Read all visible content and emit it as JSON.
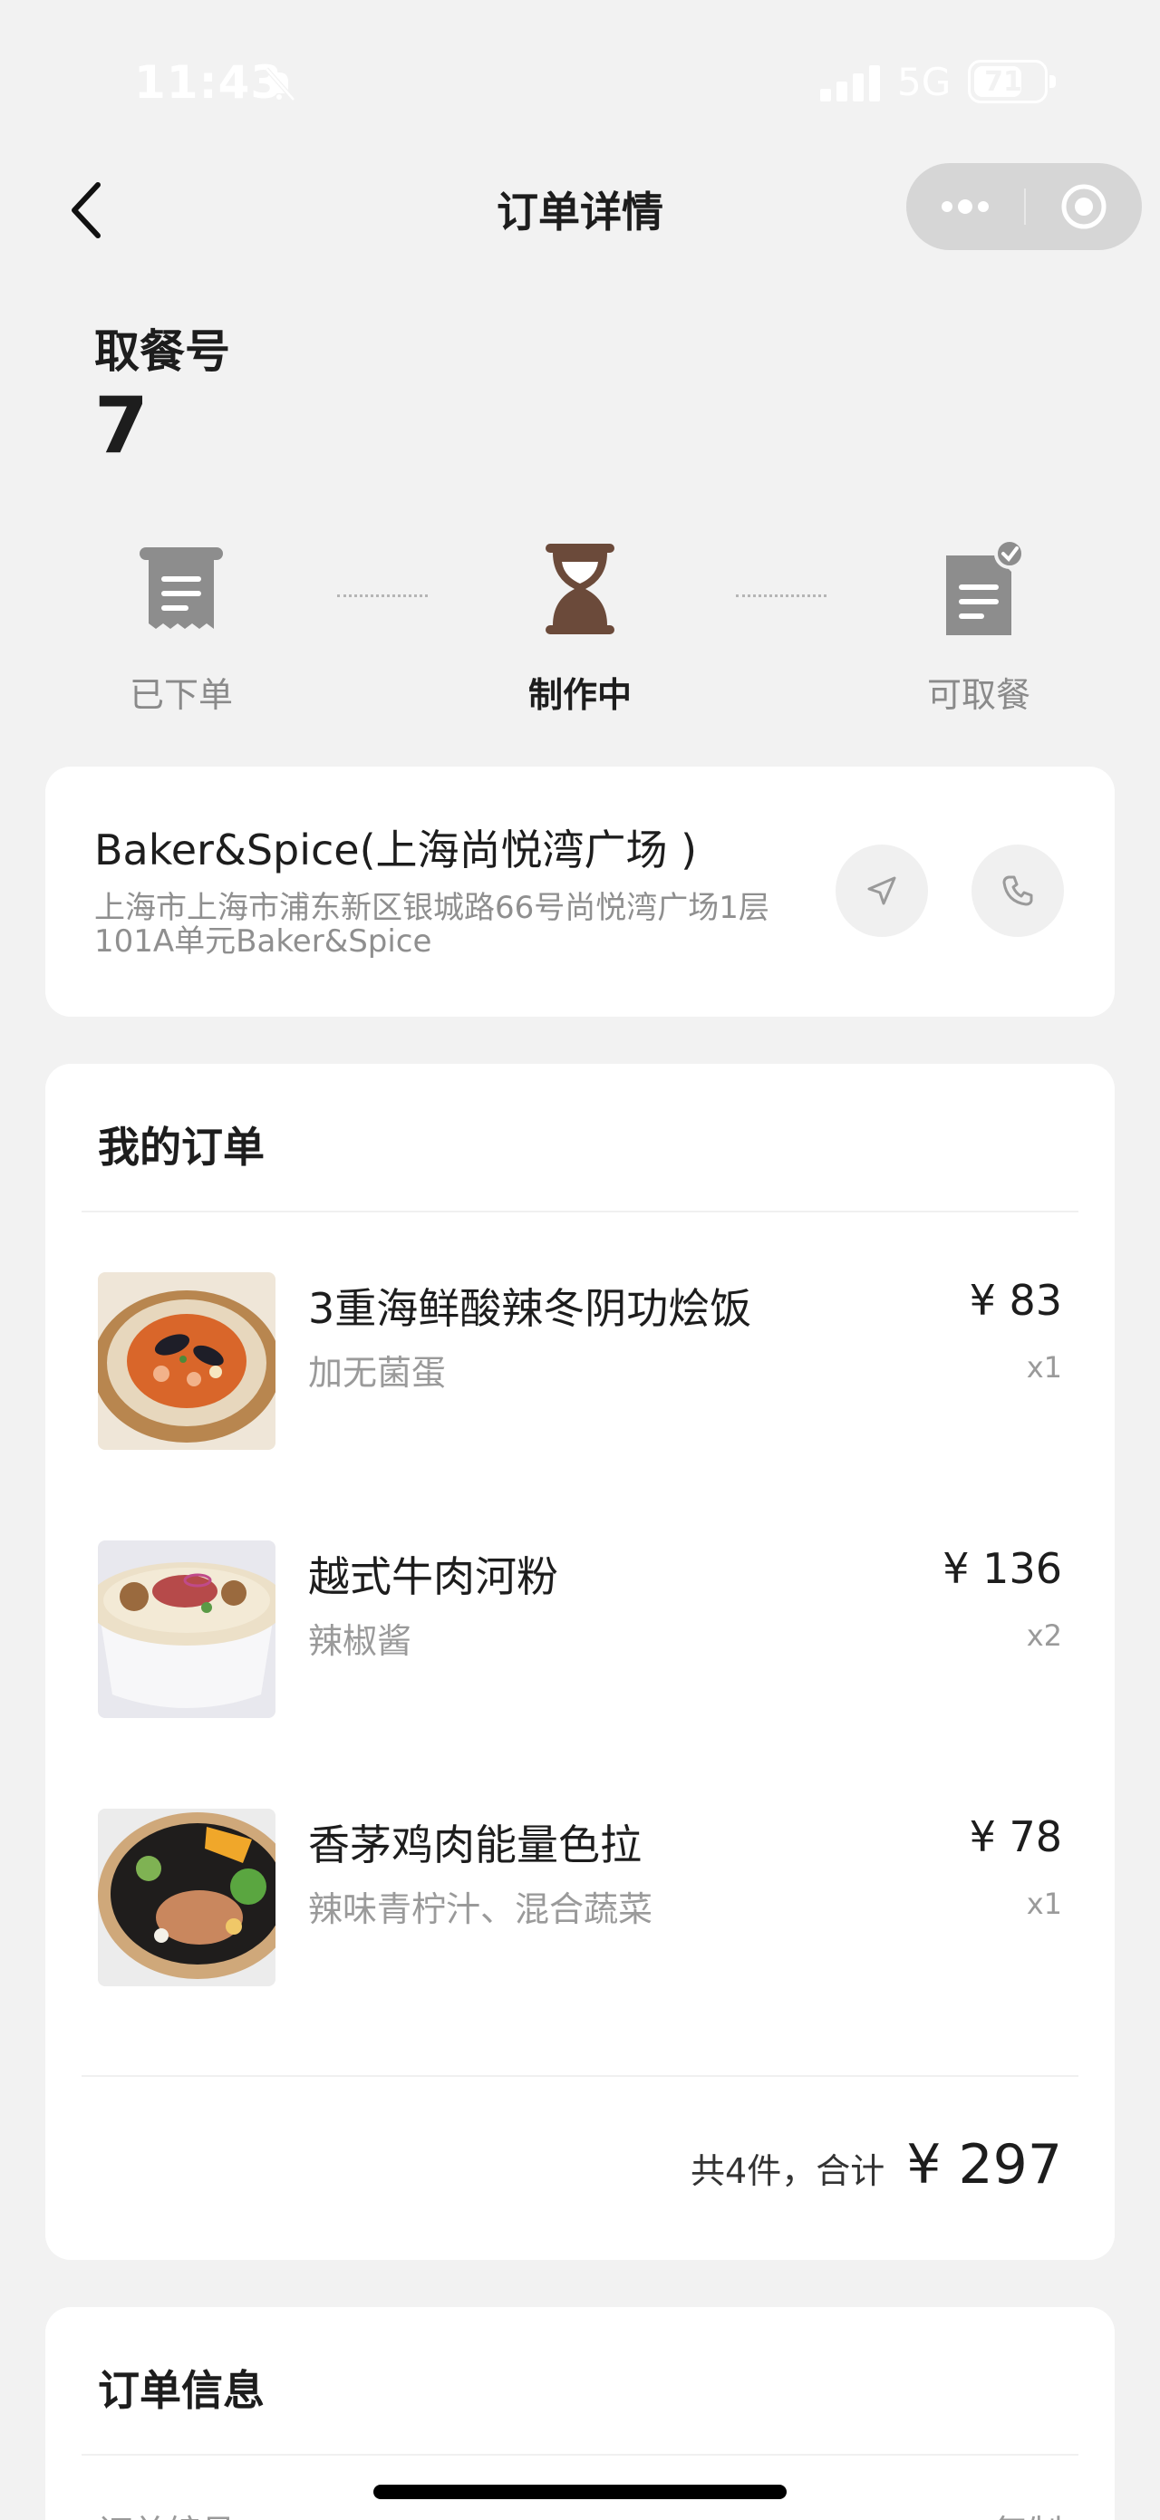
{
  "status_bar": {
    "time": "11:43",
    "network": "5G",
    "battery": "71"
  },
  "nav": {
    "title": "订单详情"
  },
  "pickup": {
    "label": "取餐号",
    "number": "7"
  },
  "steps": [
    {
      "label": "已下单",
      "state": "done"
    },
    {
      "label": "制作中",
      "state": "active"
    },
    {
      "label": "可取餐",
      "state": "pending"
    }
  ],
  "store": {
    "name": "Baker&Spice(上海尚悦湾广场 )",
    "address": "上海市上海市浦东新区银城路66号尚悦湾广场1层101A单元Baker&Spice"
  },
  "order": {
    "title": "我的订单",
    "items": [
      {
        "name": "3重海鲜酸辣冬阴功烩饭",
        "spec": "加无菌蛋",
        "price": "¥ 83",
        "qty": "x1"
      },
      {
        "name": "越式牛肉河粉",
        "spec": "辣椒酱",
        "price": "¥ 136",
        "qty": "x2"
      },
      {
        "name": "香茅鸡肉能量色拉",
        "spec": "辣味青柠汁、混合蔬菜",
        "price": "¥ 78",
        "qty": "x1"
      }
    ],
    "summary": "共4件，合计",
    "total": "¥ 297"
  },
  "info": {
    "title": "订单信息",
    "row_label": "订单编号",
    "copy": "复制"
  },
  "colors": {
    "background": "#f2f2f2",
    "card": "#ffffff",
    "active_step": "#6b4a3a",
    "muted": "#8a8a8a"
  }
}
